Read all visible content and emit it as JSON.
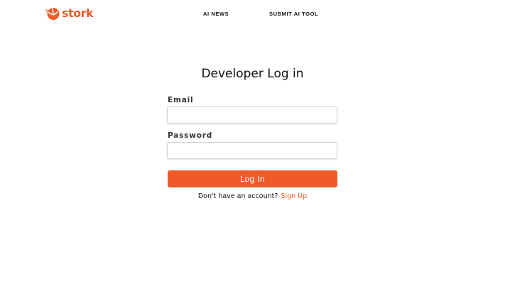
{
  "colors": {
    "accent": "#f05a2a",
    "text": "#111111",
    "label": "#333333",
    "input_border": "#cfcfcf"
  },
  "header": {
    "logo_text": "stork",
    "logo_icon": "stork-bird-icon",
    "nav": [
      {
        "label": "AI NEWS"
      },
      {
        "label": "SUBMIT AI TOOL"
      }
    ]
  },
  "form": {
    "title": "Developer Log in",
    "email": {
      "label": "Email",
      "value": "",
      "placeholder": ""
    },
    "password": {
      "label": "Password",
      "value": "",
      "placeholder": ""
    },
    "submit_label": "Log In",
    "signup_prompt": "Don't have an account?",
    "signup_link": "Sign Up"
  }
}
